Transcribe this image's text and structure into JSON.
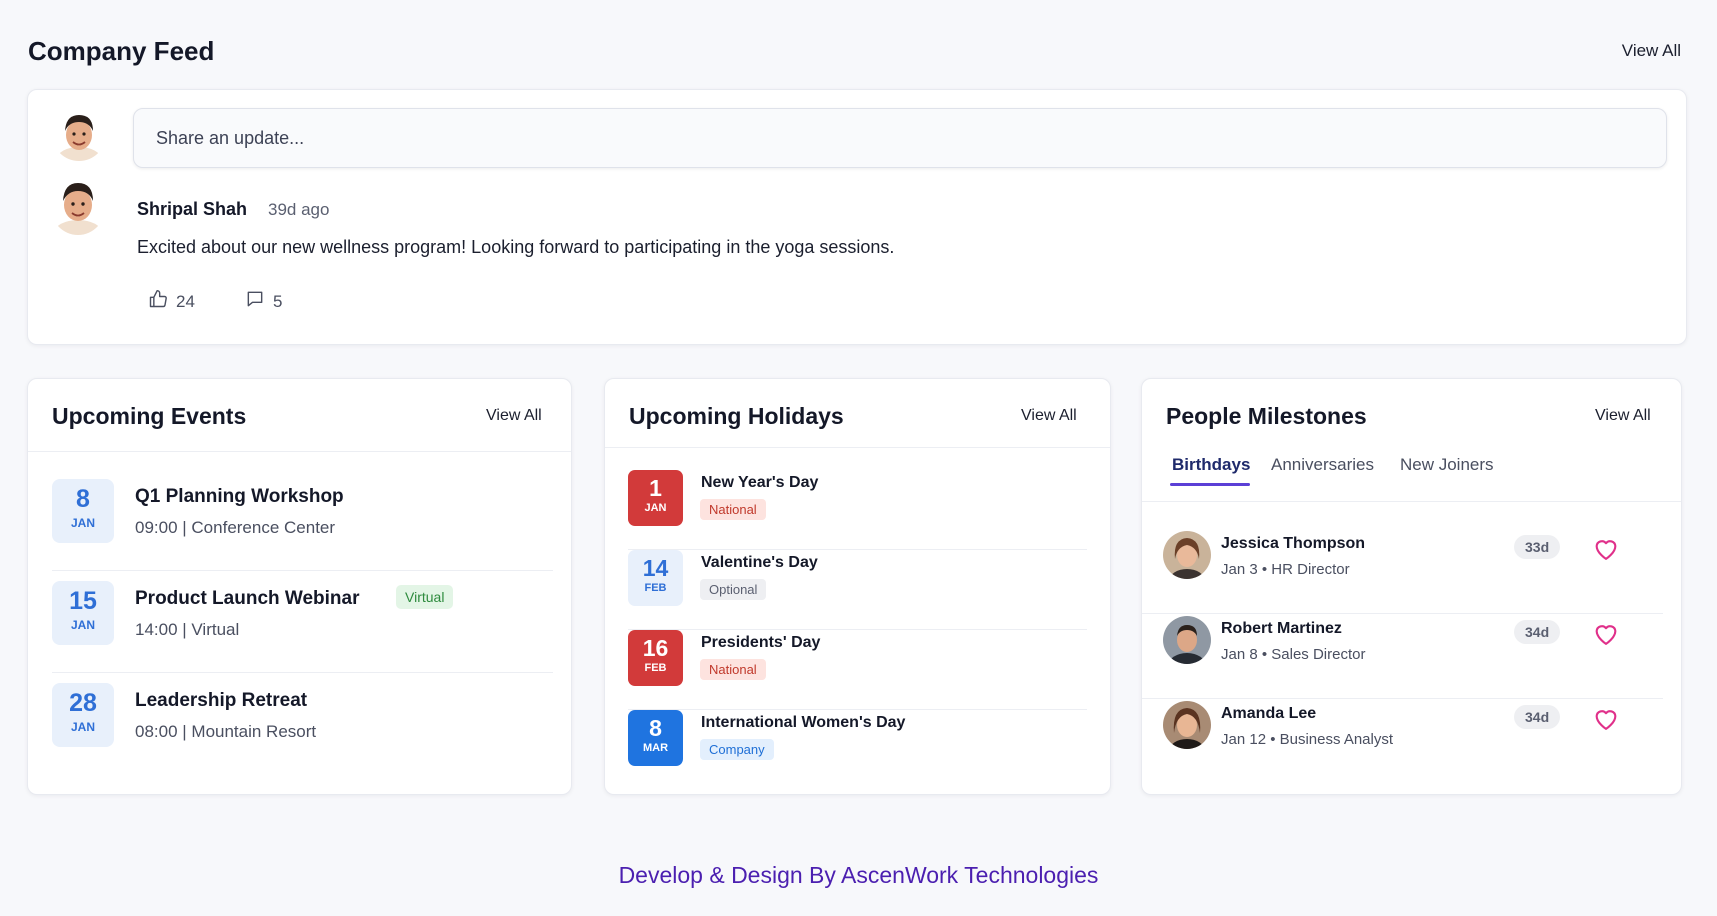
{
  "feed": {
    "title": "Company Feed",
    "view_all": "View All",
    "share_placeholder": "Share an update...",
    "post": {
      "author": "Shripal Shah",
      "time": "39d ago",
      "text": "Excited about our new wellness program! Looking forward to participating in the yoga sessions.",
      "likes": "24",
      "comments": "5"
    }
  },
  "events": {
    "title": "Upcoming Events",
    "view_all": "View All",
    "items": [
      {
        "day": "8",
        "month": "JAN",
        "title": "Q1 Planning Workshop",
        "sub": "09:00 | Conference Center"
      },
      {
        "day": "15",
        "month": "JAN",
        "title": "Product Launch Webinar",
        "sub": "14:00 | Virtual",
        "badge": "Virtual"
      },
      {
        "day": "28",
        "month": "JAN",
        "title": "Leadership Retreat",
        "sub": "08:00 | Mountain Resort"
      }
    ]
  },
  "holidays": {
    "title": "Upcoming Holidays",
    "view_all": "View All",
    "items": [
      {
        "day": "1",
        "month": "JAN",
        "title": "New Year's Day",
        "badge": "National"
      },
      {
        "day": "14",
        "month": "FEB",
        "title": "Valentine's Day",
        "badge": "Optional"
      },
      {
        "day": "16",
        "month": "FEB",
        "title": "Presidents' Day",
        "badge": "National"
      },
      {
        "day": "8",
        "month": "MAR",
        "title": "International Women's Day",
        "badge": "Company"
      }
    ]
  },
  "milestones": {
    "title": "People Milestones",
    "view_all": "View All",
    "tabs": [
      "Birthdays",
      "Anniversaries",
      "New Joiners"
    ],
    "items": [
      {
        "name": "Jessica Thompson",
        "sub": "Jan 3 • HR Director",
        "badge": "33d"
      },
      {
        "name": "Robert Martinez",
        "sub": "Jan 8 • Sales Director",
        "badge": "34d"
      },
      {
        "name": "Amanda Lee",
        "sub": "Jan 12 • Business Analyst",
        "badge": "34d"
      }
    ]
  },
  "footer": {
    "text": "Develop & Design By AscenWork Technologies"
  },
  "colors": {
    "accent": "#5b3fd6",
    "date_blue": "#2f6fd6",
    "holiday_red": "#d23a3a",
    "heart_pink": "#e0308a",
    "footer": "#4b1fb0"
  }
}
